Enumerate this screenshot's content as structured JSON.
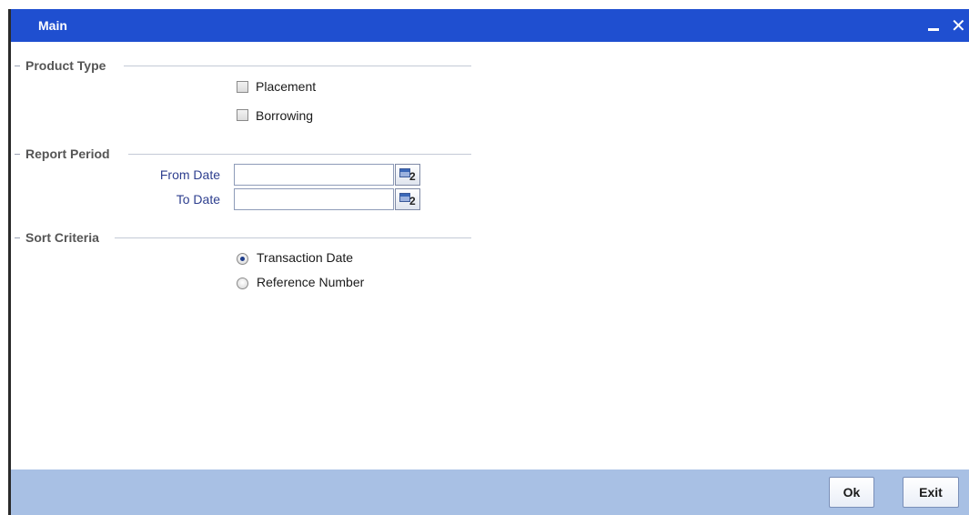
{
  "window": {
    "title": "Main",
    "minimize_glyph": "–",
    "close_glyph": "✕"
  },
  "product_type": {
    "heading": "Product Type",
    "options": [
      {
        "label": "Placement",
        "checked": false
      },
      {
        "label": "Borrowing",
        "checked": false
      }
    ]
  },
  "report_period": {
    "heading": "Report Period",
    "from_label": "From Date",
    "from_value": "",
    "to_label": "To Date",
    "to_value": "",
    "calendar_digit": "2"
  },
  "sort_criteria": {
    "heading": "Sort Criteria",
    "options": [
      {
        "label": "Transaction Date",
        "selected": true
      },
      {
        "label": "Reference Number",
        "selected": false
      }
    ]
  },
  "footer": {
    "ok_label": "Ok",
    "exit_label": "Exit"
  },
  "colors": {
    "titlebar": "#1f4fd0",
    "footer": "#a8c0e4",
    "field_label": "#2e3f8f",
    "section_heading": "#555555"
  },
  "icons": [
    "minimize-icon",
    "close-icon",
    "calendar-icon"
  ]
}
